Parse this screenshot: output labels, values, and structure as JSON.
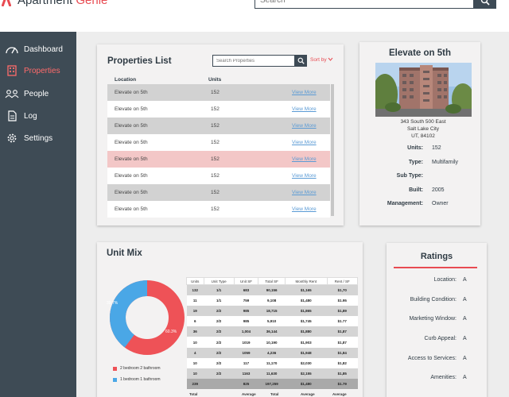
{
  "header": {
    "logo_text_a": "Apartment",
    "logo_text_b": "Genie",
    "search_placeholder": "Search"
  },
  "sidebar": {
    "items": [
      {
        "label": "Dashboard",
        "icon": "speedometer-icon",
        "active": false
      },
      {
        "label": "Properties",
        "icon": "building-icon",
        "active": true
      },
      {
        "label": "People",
        "icon": "people-icon",
        "active": false
      },
      {
        "label": "Log",
        "icon": "document-icon",
        "active": false
      },
      {
        "label": "Settings",
        "icon": "gear-icon",
        "active": false
      }
    ]
  },
  "properties_list": {
    "title": "Properties List",
    "search_placeholder": "Search Properties",
    "sort_label": "Sort by",
    "col_location": "Location",
    "col_units": "Units",
    "rows": [
      {
        "location": "Elevate on 5th",
        "units": "152",
        "link": "View More"
      },
      {
        "location": "Elevate on 5th",
        "units": "152",
        "link": "View More"
      },
      {
        "location": "Elevate on 5th",
        "units": "152",
        "link": "View More"
      },
      {
        "location": "Elevate on 5th",
        "units": "152",
        "link": "View More"
      },
      {
        "location": "Elevate on 5th",
        "units": "152",
        "link": "View More"
      },
      {
        "location": "Elevate on 5th",
        "units": "152",
        "link": "View More"
      },
      {
        "location": "Elevate on 5th",
        "units": "152",
        "link": "View More"
      },
      {
        "location": "Elevate on 5th",
        "units": "152",
        "link": "View More"
      }
    ]
  },
  "detail": {
    "title": "Elevate on 5th",
    "address_1": "343 South  500 East",
    "address_2": "Salt Lake City",
    "address_3": "UT, 84102",
    "fields": [
      {
        "key": "Units:",
        "value": "152"
      },
      {
        "key": "Type:",
        "value": "Multifamily"
      },
      {
        "key": "Sub Type:",
        "value": ""
      },
      {
        "key": "Built:",
        "value": "2005"
      },
      {
        "key": "Management:",
        "value": "Owner"
      }
    ]
  },
  "unit_mix": {
    "title": "Unit Mix",
    "pct_blue": "39.7%",
    "pct_red": "60.3%",
    "legend": [
      "2 bedroom 2 bathroom",
      "1 bedroom 1 bathroom"
    ],
    "colors": {
      "red": "#ee5257",
      "blue": "#4aa7e6"
    },
    "headers": [
      "Units",
      "Unit Type",
      "Unit SF",
      "Total SF",
      "Monthly Rent",
      "Rent / SF"
    ],
    "rows": [
      [
        "132",
        "1/1",
        "683",
        "90,156",
        "$1,165",
        "$1,70"
      ],
      [
        "11",
        "1/1",
        "759",
        "9,108",
        "$1,480",
        "$1.95"
      ],
      [
        "19",
        "2/2",
        "985",
        "18,715",
        "$1,865",
        "$1,89"
      ],
      [
        "6",
        "2/2",
        "985",
        "5,910",
        "$1,745",
        "$1.77"
      ],
      [
        "36",
        "2/2",
        "1,004",
        "36,144",
        "$1,880",
        "$1,87"
      ],
      [
        "10",
        "2/2",
        "1019",
        "10,190",
        "$1,903",
        "$1,87"
      ],
      [
        "4",
        "2/2",
        "1059",
        "4,236",
        "$1,948",
        "$1,84"
      ],
      [
        "10",
        "2/2",
        "117",
        "11,170",
        "$2,030",
        "$1,82"
      ],
      [
        "10",
        "2/2",
        "1163",
        "11,630",
        "$2,155",
        "$1,85"
      ],
      [
        "239",
        "",
        "825",
        "197,259",
        "$1,480",
        "$1.79"
      ]
    ],
    "footer": [
      "Total",
      "Average",
      "Total",
      "Average",
      "Average"
    ]
  },
  "ratings": {
    "title": "Ratings",
    "items": [
      {
        "key": "Location:",
        "value": "A"
      },
      {
        "key": "Building Condition:",
        "value": "A"
      },
      {
        "key": "Marketing Window:",
        "value": "A"
      },
      {
        "key": "Curb Appeal:",
        "value": "A"
      },
      {
        "key": "Access to Services:",
        "value": "A"
      },
      {
        "key": "Amenities:",
        "value": "A"
      }
    ]
  }
}
